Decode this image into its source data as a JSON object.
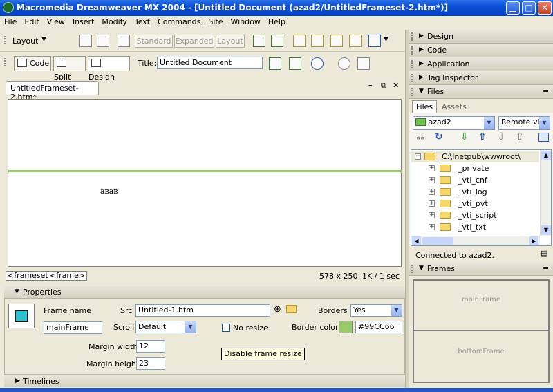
{
  "window": {
    "title": "Macromedia Dreamweaver MX 2004 - [Untitled Document (azad2/UntitledFrameset-2.htm*)]"
  },
  "menu": [
    "File",
    "Edit",
    "View",
    "Insert",
    "Modify",
    "Text",
    "Commands",
    "Site",
    "Window",
    "Help"
  ],
  "toolbar": {
    "insert_category": "Layout",
    "layout_modes": [
      "Standard",
      "Expanded",
      "Layout"
    ]
  },
  "document_toolbar": {
    "code_label": "Code",
    "split_label": "Split",
    "design_label": "Design",
    "title_label": "Title:",
    "title_value": "Untitled Document"
  },
  "document": {
    "tab_label": "UntitledFrameset-2.htm*",
    "canvas_text": "авав",
    "status_tags": [
      "<frameset>",
      "<frame>"
    ],
    "status_size": "578 x 250",
    "status_speed": "1K / 1 sec"
  },
  "properties": {
    "header": "Properties",
    "frame_name_label": "Frame name",
    "frame_name_value": "mainFrame",
    "src_label": "Src",
    "src_value": "Untitled-1.htm",
    "borders_label": "Borders",
    "borders_value": "Yes",
    "scroll_label": "Scroll",
    "scroll_value": "Default",
    "no_resize_label": "No resize",
    "border_color_label": "Border color",
    "border_color_value": "#99CC66",
    "margin_width_label": "Margin width",
    "margin_width_value": "12",
    "margin_height_label": "Margin height",
    "margin_height_value": "23",
    "tooltip": "Disable frame resize"
  },
  "timelines_label": "Timelines",
  "right_panels": {
    "collapsed": [
      "Design",
      "Code",
      "Application",
      "Tag Inspector"
    ],
    "files_header": "Files",
    "tabs": [
      "Files",
      "Assets"
    ],
    "site_value": "azad2",
    "view_value": "Remote vie",
    "root": "C:\\Inetpub\\wwwroot\\",
    "folders": [
      "_private",
      "_vti_cnf",
      "_vti_log",
      "_vti_pvt",
      "_vti_script",
      "_vti_txt"
    ],
    "connection_status": "Connected to azad2.",
    "frames_header": "Frames",
    "frame_names": [
      "mainFrame",
      "bottomFrame"
    ]
  },
  "colors": {
    "border_color": "#99CC66",
    "title_bar": "#0a4fd8"
  }
}
